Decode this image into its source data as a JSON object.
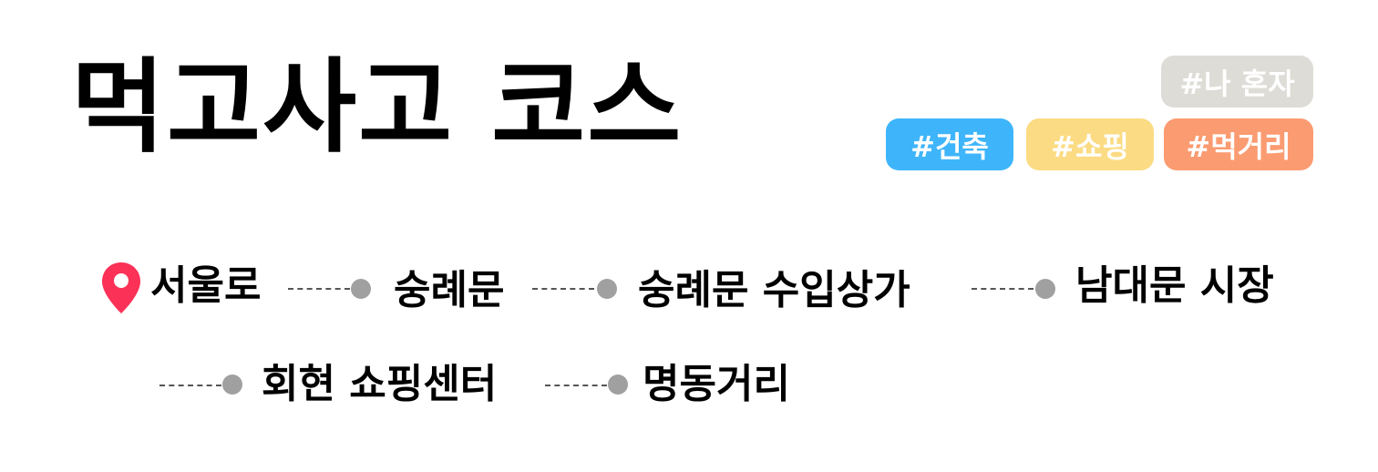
{
  "title": "먹고사고 코스",
  "tags": [
    {
      "label": "#나 혼자",
      "color": "#dedcd6"
    },
    {
      "label": "#건축",
      "color": "#3eb5fb"
    },
    {
      "label": "#쇼핑",
      "color": "#fbdb83"
    },
    {
      "label": "#먹거리",
      "color": "#fb9b71"
    }
  ],
  "course": {
    "start_icon": "map-pin-icon",
    "stops": [
      "서울로",
      "숭례문",
      "숭례문 수입상가",
      "남대문 시장",
      "회현 쇼핑센터",
      "명동거리"
    ]
  },
  "colors": {
    "pin": "#fb3157",
    "dot": "#a0a0a0",
    "dash": "#555555"
  }
}
